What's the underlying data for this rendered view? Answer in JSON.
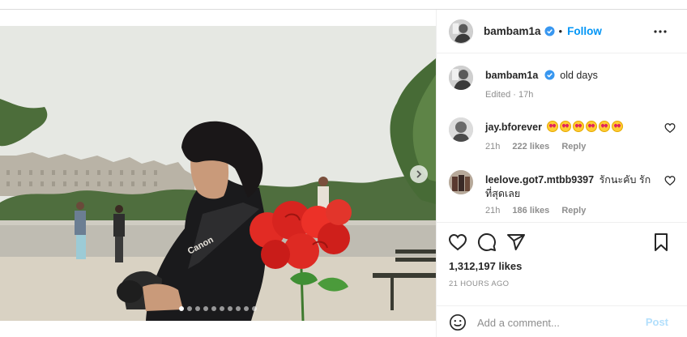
{
  "post": {
    "media": {
      "slide_count": 10,
      "active_slide": 1,
      "strap_text": "Canon"
    },
    "header": {
      "username": "bambam1a",
      "separator": "•",
      "follow_label": "Follow",
      "more_icon": "more-horizontal-icon"
    },
    "caption": {
      "username": "bambam1a",
      "text": "old days",
      "meta": "Edited · 17h"
    },
    "comments": [
      {
        "username": "jay.bforever",
        "text": "",
        "emoji_count": 6,
        "time": "21h",
        "likes": "222 likes",
        "reply": "Reply"
      },
      {
        "username": "leelove.got7.mtbb9397",
        "text": "รักนะคับ รักที่สุดเลย",
        "time": "21h",
        "likes": "186 likes",
        "reply": "Reply"
      }
    ],
    "actions": {
      "like_icon": "heart-icon",
      "comment_icon": "comment-icon",
      "share_icon": "share-icon",
      "save_icon": "bookmark-icon"
    },
    "likes_count": "1,312,197 likes",
    "timestamp": "21 HOURS AGO",
    "add_comment": {
      "placeholder": "Add a comment...",
      "post_label": "Post",
      "emoji_icon": "emoji-icon"
    },
    "colors": {
      "accent": "#0095f6",
      "post_disabled": "#b2dffc",
      "verified": "#3897f0"
    }
  }
}
